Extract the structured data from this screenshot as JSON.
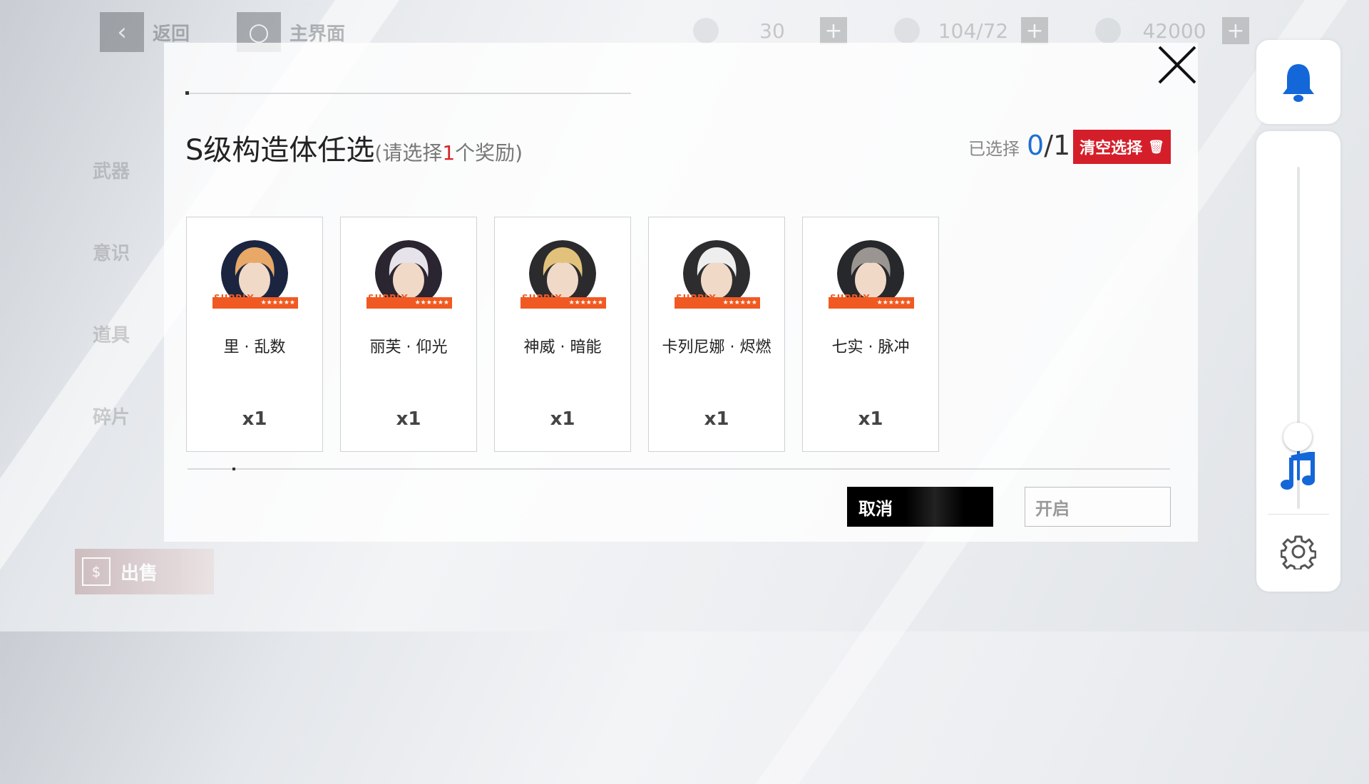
{
  "topbar": {
    "back_label": "返回",
    "home_label": "主界面",
    "resources": [
      {
        "icon": "stamina-icon",
        "value": "30"
      },
      {
        "icon": "energy-icon",
        "value": "104/72"
      },
      {
        "icon": "coin-icon",
        "value": "42000"
      }
    ]
  },
  "leftnav": {
    "items": [
      "武器",
      "意识",
      "道具",
      "碎片"
    ],
    "sell_label": "出售"
  },
  "modal": {
    "title": "S级构造体任选",
    "subtitle_prefix": "(请选择",
    "subtitle_count": "1",
    "subtitle_suffix": "个奖励)",
    "selected_label": "已选择",
    "selected_count": "0",
    "selected_sep": "/",
    "selected_total": "1",
    "clear_label": "清空选择",
    "cards": [
      {
        "name": "里 · 乱数",
        "qty": "x1",
        "hair": "#e8a867",
        "bg": "#1b2540"
      },
      {
        "name": "丽芙 · 仰光",
        "qty": "x1",
        "hair": "#e7e3ea",
        "bg": "#2a2530"
      },
      {
        "name": "神威 · 暗能",
        "qty": "x1",
        "hair": "#e2c27a",
        "bg": "#2b2b2e"
      },
      {
        "name": "卡列尼娜 · 烬燃",
        "qty": "x1",
        "hair": "#eeeeee",
        "bg": "#2d2d2f"
      },
      {
        "name": "七实 · 脉冲",
        "qty": "x1",
        "hair": "#9a9590",
        "bg": "#26282c"
      }
    ],
    "supply_tag": "SUPPLY",
    "supply_stars": "★★★★★★",
    "cancel_label": "取消",
    "open_label": "开启"
  },
  "system": {
    "volume_level": 0.21,
    "accent": "#1467d8"
  }
}
